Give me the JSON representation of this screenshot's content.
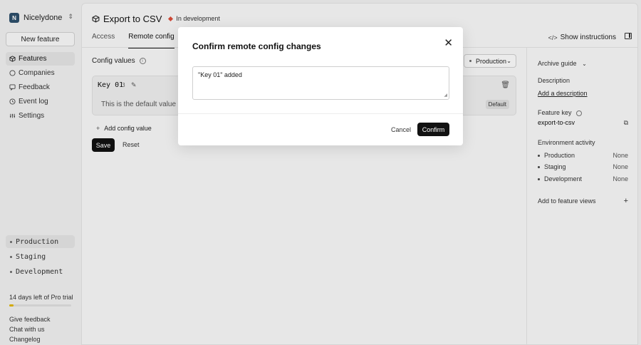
{
  "sidebar": {
    "org": {
      "initial": "N",
      "name": "Nicelydone"
    },
    "new_feature": "New feature",
    "nav": [
      {
        "label": "Features",
        "icon": "box-icon"
      },
      {
        "label": "Companies",
        "icon": "building-icon"
      },
      {
        "label": "Feedback",
        "icon": "feedback-icon"
      },
      {
        "label": "Event log",
        "icon": "clock-icon"
      },
      {
        "label": "Settings",
        "icon": "settings-icon"
      }
    ],
    "environments": [
      {
        "label": "Production"
      },
      {
        "label": "Staging"
      },
      {
        "label": "Development"
      }
    ],
    "trial": {
      "text": "14 days left of Pro trial",
      "progress": 0.07,
      "color": "#e0b400"
    },
    "footer_links": [
      "Give feedback",
      "Chat with us",
      "Changelog"
    ]
  },
  "header": {
    "title": "Export to CSV",
    "status": "In development",
    "status_color": "#d94d3a",
    "tabs": [
      "Access",
      "Remote config"
    ],
    "show_instructions": "Show instructions",
    "code_symbol": "</>"
  },
  "config": {
    "heading": "Config values",
    "info_symbol": "i",
    "environment": "Production",
    "card": {
      "key": "Key 01",
      "count": "3",
      "description": "This is the default value for th",
      "badge": "Default"
    },
    "add_value": "Add config value",
    "save": "Save",
    "reset": "Reset"
  },
  "right_panel": {
    "archive_guide": "Archive guide",
    "description_label": "Description",
    "add_description": "Add a description",
    "feature_key_label": "Feature key",
    "feature_key": "export-to-csv",
    "env_activity_label": "Environment activity",
    "env_activity": [
      {
        "name": "Production",
        "value": "None"
      },
      {
        "name": "Staging",
        "value": "None"
      },
      {
        "name": "Development",
        "value": "None"
      }
    ],
    "add_to_views": "Add to feature views",
    "plus": "+"
  },
  "modal": {
    "title": "Confirm remote config changes",
    "textarea_value": "\"Key 01\" added",
    "cancel": "Cancel",
    "confirm": "Confirm"
  }
}
